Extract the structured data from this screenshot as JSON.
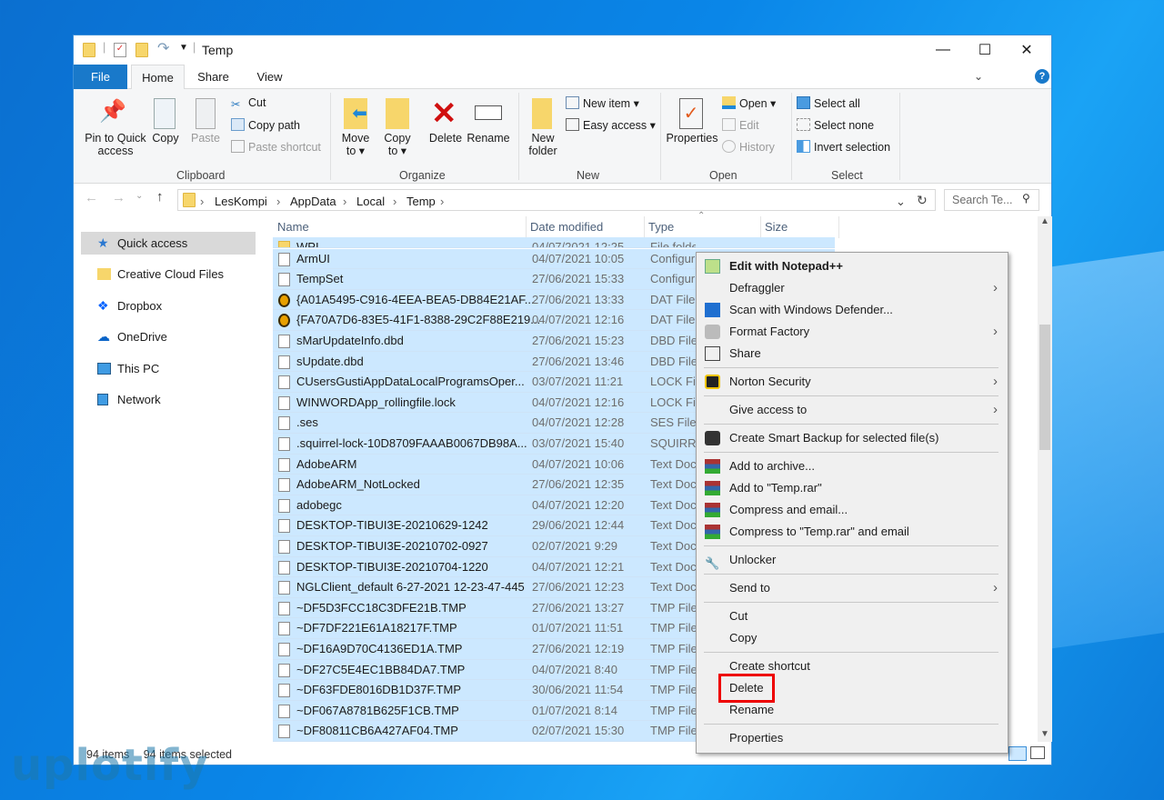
{
  "window": {
    "title": "Temp",
    "controls": {
      "minimize": "—",
      "maximize": "☐",
      "close": "✕"
    }
  },
  "tabs": [
    "File",
    "Home",
    "Share",
    "View"
  ],
  "ribbon": {
    "clipboard": {
      "label": "Clipboard",
      "pin": "Pin to Quick access",
      "copy": "Copy",
      "paste": "Paste",
      "cut": "Cut",
      "copy_path": "Copy path",
      "paste_shortcut": "Paste shortcut"
    },
    "organize": {
      "label": "Organize",
      "move_to": "Move to ▾",
      "copy_to": "Copy to ▾",
      "delete": "Delete",
      "rename": "Rename"
    },
    "new": {
      "label": "New",
      "new_folder": "New folder",
      "new_item": "New item ▾",
      "easy_access": "Easy access ▾"
    },
    "open": {
      "label": "Open",
      "properties": "Properties",
      "open": "Open ▾",
      "edit": "Edit",
      "history": "History"
    },
    "select": {
      "label": "Select",
      "select_all": "Select all",
      "select_none": "Select none",
      "invert": "Invert selection"
    }
  },
  "address": {
    "crumbs": [
      "LesKompi",
      "AppData",
      "Local",
      "Temp"
    ],
    "search_placeholder": "Search Te..."
  },
  "nav": [
    "Quick access",
    "Creative Cloud Files",
    "Dropbox",
    "OneDrive",
    "This PC",
    "Network"
  ],
  "columns": [
    "Name",
    "Date modified",
    "Type",
    "Size"
  ],
  "files": [
    {
      "name": "WPI",
      "date": "04/07/2021 12:25",
      "type": "File folder",
      "icon": "folder"
    },
    {
      "name": "ArmUI",
      "date": "04/07/2021 10:05",
      "type": "Configur",
      "icon": "config"
    },
    {
      "name": "TempSet",
      "date": "27/06/2021 15:33",
      "type": "Configur",
      "icon": "config"
    },
    {
      "name": "{A01A5495-C916-4EEA-BEA5-DB84E21AF...",
      "date": "27/06/2021 13:33",
      "type": "DAT File",
      "icon": "dat"
    },
    {
      "name": "{FA70A7D6-83E5-41F1-8388-29C2F88E219...",
      "date": "04/07/2021 12:16",
      "type": "DAT File",
      "icon": "dat"
    },
    {
      "name": "sMarUpdateInfo.dbd",
      "date": "27/06/2021 15:23",
      "type": "DBD File",
      "icon": "file"
    },
    {
      "name": "sUpdate.dbd",
      "date": "27/06/2021 13:46",
      "type": "DBD File",
      "icon": "file"
    },
    {
      "name": "CUsersGustiAppDataLocalProgramsOper...",
      "date": "03/07/2021 11:21",
      "type": "LOCK File",
      "icon": "file"
    },
    {
      "name": "WINWORDApp_rollingfile.lock",
      "date": "04/07/2021 12:16",
      "type": "LOCK File",
      "icon": "file"
    },
    {
      "name": ".ses",
      "date": "04/07/2021 12:28",
      "type": "SES File",
      "icon": "file"
    },
    {
      "name": ".squirrel-lock-10D8709FAAAB0067DB98A...",
      "date": "03/07/2021 15:40",
      "type": "SQUIRRE",
      "icon": "file"
    },
    {
      "name": "AdobeARM",
      "date": "04/07/2021 10:06",
      "type": "Text Doc",
      "icon": "file"
    },
    {
      "name": "AdobeARM_NotLocked",
      "date": "27/06/2021 12:35",
      "type": "Text Doc",
      "icon": "file"
    },
    {
      "name": "adobegc",
      "date": "04/07/2021 12:20",
      "type": "Text Doc",
      "icon": "file"
    },
    {
      "name": "DESKTOP-TIBUI3E-20210629-1242",
      "date": "29/06/2021 12:44",
      "type": "Text Doc",
      "icon": "file"
    },
    {
      "name": "DESKTOP-TIBUI3E-20210702-0927",
      "date": "02/07/2021 9:29",
      "type": "Text Doc",
      "icon": "file"
    },
    {
      "name": "DESKTOP-TIBUI3E-20210704-1220",
      "date": "04/07/2021 12:21",
      "type": "Text Doc",
      "icon": "file"
    },
    {
      "name": "NGLClient_default 6-27-2021 12-23-47-445",
      "date": "27/06/2021 12:23",
      "type": "Text Doc",
      "icon": "file"
    },
    {
      "name": "~DF5D3FCC18C3DFE21B.TMP",
      "date": "27/06/2021 13:27",
      "type": "TMP File",
      "icon": "file"
    },
    {
      "name": "~DF7DF221E61A18217F.TMP",
      "date": "01/07/2021 11:51",
      "type": "TMP File",
      "icon": "file"
    },
    {
      "name": "~DF16A9D70C4136ED1A.TMP",
      "date": "27/06/2021 12:19",
      "type": "TMP File",
      "icon": "file"
    },
    {
      "name": "~DF27C5E4EC1BB84DA7.TMP",
      "date": "04/07/2021 8:40",
      "type": "TMP File",
      "icon": "file"
    },
    {
      "name": "~DF63FDE8016DB1D37F.TMP",
      "date": "30/06/2021 11:54",
      "type": "TMP File",
      "icon": "file"
    },
    {
      "name": "~DF067A8781B625F1CB.TMP",
      "date": "01/07/2021 8:14",
      "type": "TMP File",
      "icon": "file"
    },
    {
      "name": "~DF80811CB6A427AF04.TMP",
      "date": "02/07/2021 15:30",
      "type": "TMP File",
      "icon": "file"
    }
  ],
  "status": {
    "count": "94 items",
    "selected": "94 items selected"
  },
  "context_menu": [
    {
      "label": "Edit with Notepad++",
      "icon": "notepad",
      "bold": true
    },
    {
      "label": "Defraggler",
      "sub": true
    },
    {
      "label": "Scan with Windows Defender...",
      "icon": "defender"
    },
    {
      "label": "Format Factory",
      "icon": "formatfactory",
      "sub": true
    },
    {
      "label": "Share",
      "icon": "share"
    },
    {
      "sep": true
    },
    {
      "label": "Norton Security",
      "icon": "norton",
      "sub": true
    },
    {
      "sep": true
    },
    {
      "label": "Give access to",
      "sub": true
    },
    {
      "sep": true
    },
    {
      "label": "Create Smart Backup for selected file(s)",
      "icon": "backup"
    },
    {
      "sep": true
    },
    {
      "label": "Add to archive...",
      "icon": "winrar"
    },
    {
      "label": "Add to \"Temp.rar\"",
      "icon": "winrar"
    },
    {
      "label": "Compress and email...",
      "icon": "winrar"
    },
    {
      "label": "Compress to \"Temp.rar\" and email",
      "icon": "winrar"
    },
    {
      "sep": true
    },
    {
      "label": "Unlocker",
      "icon": "unlocker"
    },
    {
      "sep": true
    },
    {
      "label": "Send to",
      "sub": true
    },
    {
      "sep": true
    },
    {
      "label": "Cut"
    },
    {
      "label": "Copy"
    },
    {
      "sep": true
    },
    {
      "label": "Create shortcut"
    },
    {
      "label": "Delete",
      "highlight": true
    },
    {
      "label": "Rename"
    },
    {
      "sep": true
    },
    {
      "label": "Properties"
    }
  ],
  "colors": {
    "highlight": "#ee0000",
    "selection": "#cce8ff",
    "accent": "#1979ca"
  },
  "watermark": "uplotify"
}
